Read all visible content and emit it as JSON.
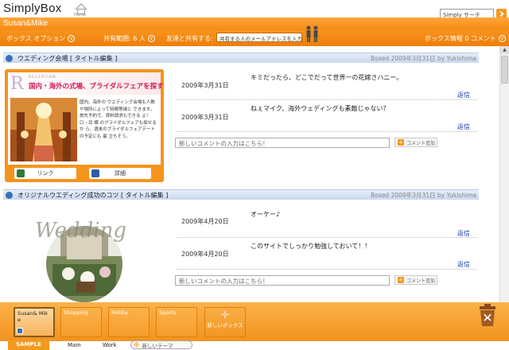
{
  "header": {
    "logo": "SimplyBox",
    "home_label": "Home",
    "username": "Susan&Mike",
    "search_value": "Simply サーチ"
  },
  "toolbar": {
    "box_options": "ボックス オプション",
    "shared_label": "共有範囲: 6 人",
    "share_with_friends": "友達と共有する:",
    "share_input_placeholder": "共有する人のメールアドレスを入力",
    "box_info": "ボックス情報 0 コメント"
  },
  "sections": [
    {
      "title": "ウエディング会場 [ タイトル編集 ]",
      "meta": "Boxed 2009年3月31日 by Yukishima",
      "card": {
        "reception": "RECEPTION",
        "headline": "国内・海外の式場、ブライダルフェアを探す",
        "body": "国内、海外の ウエディング会場も人数 や場所によって特徴等細と できます。旅先予約で、資料請求もできる よ！  口・目 標 のブライダルフェアも探せるか ら、週末のブライダルフェアデートの予定にも 最 立ちそう。",
        "link_label": "リンク",
        "detail_label": "詳細"
      },
      "comments": [
        {
          "date": "2009年3月31日",
          "text": "キミだったら、どこでだって世界一の花嫁さハニー。",
          "reply": "返信"
        },
        {
          "date": "2009年3月31日",
          "text": "ねぇマイク、海外ウェディングも素敵じゃない？",
          "reply": "返信"
        }
      ],
      "comment_placeholder": "新しいコメントの入力はこちら！",
      "add_comment": "コメント追加"
    },
    {
      "title": "オリジナルウエディング成功のコツ [ タイトル編集 ]",
      "meta": "Boxed 2009年3月31日 by Yukishima",
      "image_text": "Wedding",
      "comments": [
        {
          "date": "2009年4月20日",
          "text": "オーケー♪",
          "reply": "返信"
        },
        {
          "date": "2009年4月20日",
          "text": "このサイトでしっかり勉強しておいて！！",
          "reply": "返信"
        }
      ],
      "comment_placeholder": "新しいコメントの入力はこちら！",
      "add_comment": "コメント追加"
    }
  ],
  "dock": {
    "boxes": [
      "Susan& Mik e",
      "Shopping",
      "Hobby",
      "Sports"
    ],
    "new_box": "新しいボックス"
  },
  "tabs": {
    "items": [
      "SAMPLE",
      "Main",
      "Work"
    ],
    "new_theme": "新しいテーマ"
  },
  "colors": {
    "accent": "#f39a1e",
    "link": "#1a3ea8",
    "section_bar": "#c9d8ef"
  }
}
